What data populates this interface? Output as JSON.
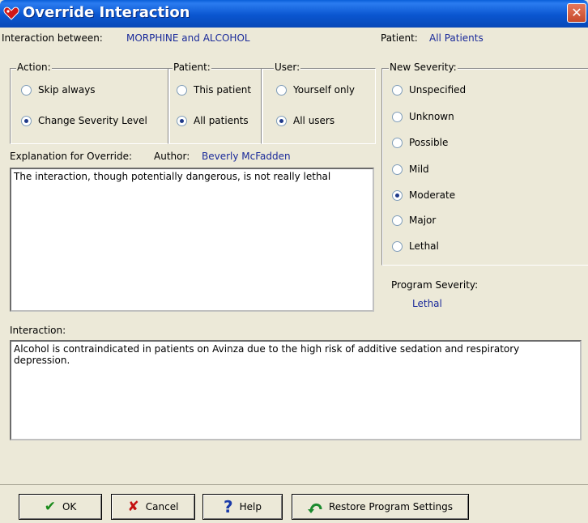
{
  "window": {
    "title": "Override Interaction",
    "close_icon": "close-icon"
  },
  "header": {
    "interaction_label": "Interaction between:",
    "interaction_value": "MORPHINE and ALCOHOL",
    "patient_label": "Patient:",
    "patient_value": "All Patients"
  },
  "action": {
    "label": "Action:",
    "options": [
      {
        "label": "Skip always",
        "selected": false
      },
      {
        "label": "Change Severity Level",
        "selected": true
      }
    ]
  },
  "patient_group": {
    "label": "Patient:",
    "options": [
      {
        "label": "This patient",
        "selected": false
      },
      {
        "label": "All patients",
        "selected": true
      }
    ]
  },
  "user_group": {
    "label": "User:",
    "options": [
      {
        "label": "Yourself only",
        "selected": false
      },
      {
        "label": "All users",
        "selected": true
      }
    ]
  },
  "severity": {
    "label": "New Severity:",
    "options": [
      {
        "label": "Unspecified",
        "selected": false
      },
      {
        "label": "Unknown",
        "selected": false
      },
      {
        "label": "Possible",
        "selected": false
      },
      {
        "label": "Mild",
        "selected": false
      },
      {
        "label": "Moderate",
        "selected": true
      },
      {
        "label": "Major",
        "selected": false
      },
      {
        "label": "Lethal",
        "selected": false
      }
    ]
  },
  "explanation": {
    "label": "Explanation for Override:",
    "author_label": "Author:",
    "author_value": "Beverly McFadden",
    "text": "The interaction, though potentially dangerous, is not really lethal"
  },
  "program_severity": {
    "label": "Program Severity:",
    "value": "Lethal"
  },
  "interaction": {
    "label": "Interaction:",
    "text": "Alcohol is contraindicated in patients on Avinza due to the high risk of additive sedation and respiratory depression."
  },
  "buttons": {
    "ok": "OK",
    "cancel": "Cancel",
    "help": "Help",
    "restore": "Restore Program Settings"
  }
}
